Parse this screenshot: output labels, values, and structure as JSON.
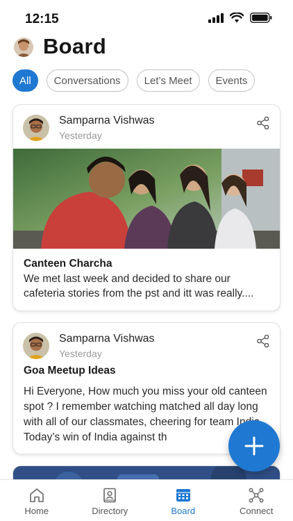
{
  "status_bar": {
    "time": "12:15"
  },
  "header": {
    "title": "Board"
  },
  "filters": [
    {
      "label": "All",
      "active": true
    },
    {
      "label": "Conversations",
      "active": false
    },
    {
      "label": "Let’s Meet",
      "active": false
    },
    {
      "label": "Events",
      "active": false
    }
  ],
  "posts": [
    {
      "author": "Samparna Vishwas",
      "time": "Yesterday",
      "title": "Canteen Charcha",
      "text": "We met last week and decided to share our cafeteria stories from the pst and itt was really...."
    },
    {
      "author": "Samparna Vishwas",
      "time": "Yesterday",
      "title": "Goa Meetup Ideas",
      "text": "Hi Everyone, How much you miss your old canteen spot ? I remember watching matched all day long with all of our classmates, cheering for team India. Today’s win of India against th"
    }
  ],
  "tabs": [
    {
      "label": "Home",
      "icon": "home-icon"
    },
    {
      "label": "Directory",
      "icon": "directory-icon"
    },
    {
      "label": "Board",
      "icon": "board-icon",
      "active": true
    },
    {
      "label": "Connect",
      "icon": "connect-icon"
    }
  ],
  "colors": {
    "accent": "#1f78d1"
  }
}
